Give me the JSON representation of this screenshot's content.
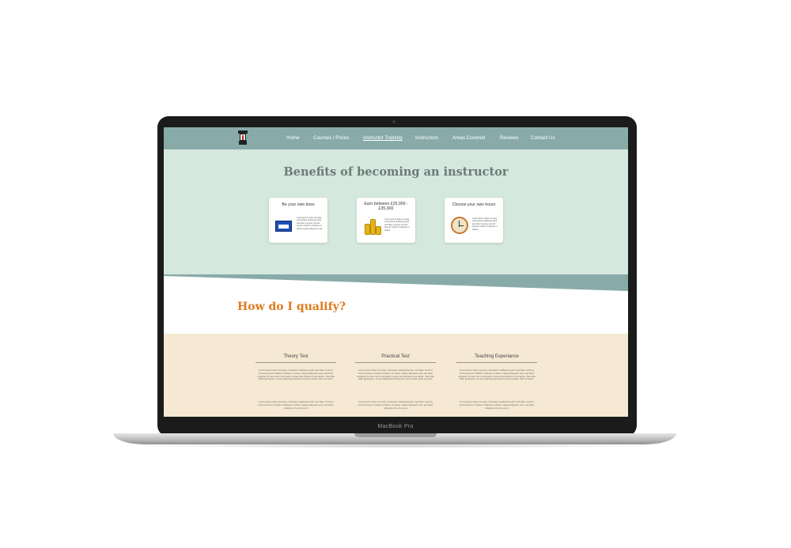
{
  "device": {
    "model": "MacBook Pro"
  },
  "nav": {
    "items": [
      {
        "label": "Home",
        "active": false
      },
      {
        "label": "Courses / Prices",
        "active": false
      },
      {
        "label": "Instructor Training",
        "active": true
      },
      {
        "label": "Instructors",
        "active": false
      },
      {
        "label": "Areas Covered",
        "active": false
      },
      {
        "label": "Reviews",
        "active": false
      },
      {
        "label": "Contact Us",
        "active": false
      }
    ]
  },
  "benefits": {
    "title": "Benefits of becoming an instructor",
    "cards": [
      {
        "title": "Be your own boss",
        "icon": "sign-icon",
        "text": "Lorem ipsum dolor sit amet, consectetur sadipscing elitr, sed diam nonumy eirmod tempor invidunt ut labore et dolore magna aliquyam erat."
      },
      {
        "title": "Earn between £25,000 - £35,000",
        "icon": "coins-icon",
        "text": "Lorem ipsum dolor sit amet, consectetur sadipscing elitr, sed diam nonumy eirmod tempor invidunt ut labore et dolore."
      },
      {
        "title": "Choose your own hours",
        "icon": "clock-icon",
        "text": "Lorem ipsum dolor sit amet, consectetur sadipscing elitr, sed diam nonumy eirmod tempor invidunt ut labore et dolore."
      }
    ]
  },
  "qualify": {
    "title": "How do I qualify?",
    "columns": [
      {
        "title": "Theory Test",
        "p1": "Lorem ipsum dolor sit amet, consetetur sadipscing elitr, sed diam nonumy eirmod tempor invidunt ut labore et dolore magna aliquyam erat, sed diam voluptua. At vero eos et accusam et justo duo dolores et ea rebum. Stet clita kasd gubergren, no sea takimata sanctus est Lorem ipsum dolor sit amet.",
        "p2": "Lorem ipsum dolor sit amet, consetetur sadipscing elitr, sed diam nonumy eirmod tempor invidunt ut labore et dolore magna aliquyam erat, sed diam voluptua. At vero eos et"
      },
      {
        "title": "Practical Test",
        "p1": "Lorem ipsum dolor sit amet, consetetur sadipscing elitr, sed diam nonumy eirmod tempor invidunt ut labore et dolore magna aliquyam erat, sed diam voluptua. At vero eos et accusam et justo duo dolores et ea rebum. Stet clita kasd gubergren, no sea takimata sanctus est Lorem ipsum dolor sit amet.",
        "p2": "Lorem ipsum dolor sit amet, consetetur sadipscing elitr, sed diam nonumy eirmod tempor invidunt ut labore et dolore magna aliquyam erat, sed diam voluptua. At vero eos et"
      },
      {
        "title": "Teaching Experiance",
        "p1": "Lorem ipsum dolor sit amet, consetetur sadipscing elitr, sed diam nonumy eirmod tempor invidunt ut labore et dolore magna aliquyam erat, sed diam voluptua. At vero eos et accusam et justo duo dolores et ea rebum. Stet clita kasd gubergren, no sea takimata sanctus est Lorem ipsum dolor sit amet.",
        "p2": "Lorem ipsum dolor sit amet, consetetur sadipscing elitr, sed diam nonumy eirmod tempor invidunt ut labore et dolore magna aliquyam erat, sed diam voluptua. At vero eos et"
      }
    ]
  },
  "colors": {
    "nav_bg": "#88aba9",
    "hero_bg": "#d5e8de",
    "heading_grey": "#6d7a78",
    "accent_orange": "#e07a1b",
    "beige_bg": "#f5e9d3"
  }
}
